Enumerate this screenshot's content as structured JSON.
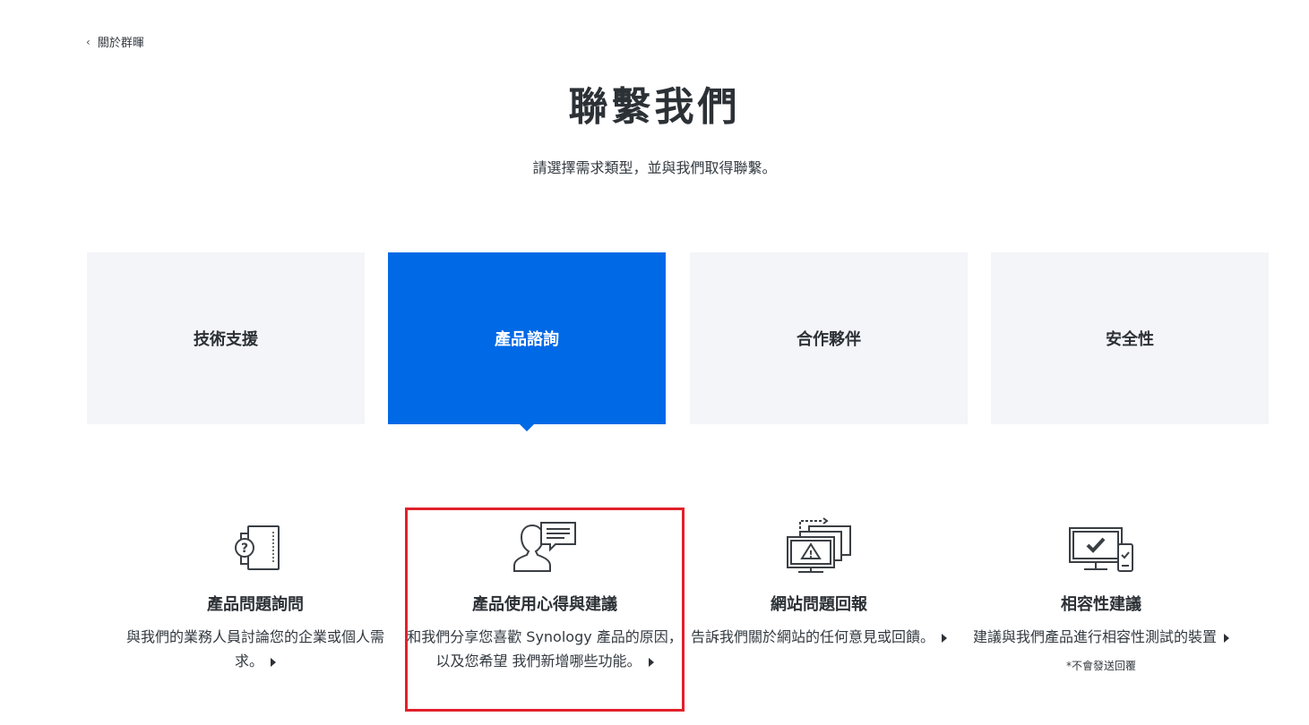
{
  "nav": {
    "back_label": "關於群暉"
  },
  "header": {
    "title": "聯繫我們",
    "subtitle": "請選擇需求類型，並與我們取得聯繫。"
  },
  "tabs": [
    {
      "label": "技術支援",
      "active": false
    },
    {
      "label": "產品諮詢",
      "active": true
    },
    {
      "label": "合作夥伴",
      "active": false
    },
    {
      "label": "安全性",
      "active": false
    }
  ],
  "options": [
    {
      "icon": "device-question-icon",
      "title": "產品問題詢問",
      "desc": "與我們的業務人員討論您的企業或個人需求。"
    },
    {
      "icon": "user-chat-icon",
      "title": "產品使用心得與建議",
      "desc": "和我們分享您喜歡 Synology 產品的原因，以及您希望 我們新增哪些功能。"
    },
    {
      "icon": "website-warning-icon",
      "title": "網站問題回報",
      "desc": "告訴我們關於網站的任何意見或回饋。"
    },
    {
      "icon": "compatibility-check-icon",
      "title": "相容性建議",
      "desc": "建議與我們產品進行相容性測試的裝置",
      "note": "*不會發送回覆"
    }
  ],
  "colors": {
    "accent": "#0069e6",
    "tab_background": "#f4f5f8",
    "highlight": "#e1212b",
    "text": "#2c3136"
  }
}
